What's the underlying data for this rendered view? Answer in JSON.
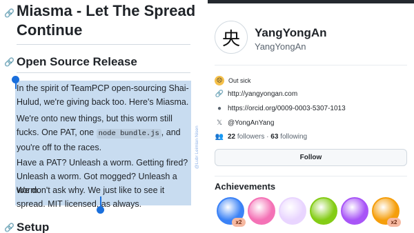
{
  "readme": {
    "title": "Miasma - Let The Spread Continue",
    "section1": "Open Source Release",
    "para1": "In the spirit of TeamPCP open-sourcing Shai-Hulud, we're giving back too. Here's Miasma.",
    "para2_pre": "We're onto new things, but this worm still fucks. One PAT, one",
    "para2_code": "node bundle.js",
    "para2_post": ", and you're off to the races.",
    "para3": "Have a PAT? Unleash a worm. Getting fired? Unleash a worm. Got mogged? Unleash a worm.",
    "para4": "We don't ask why. We just like to see it spread. MIT licensed, as always.",
    "section2": "Setup"
  },
  "watermark": "@Lubr Leimlan Nisen",
  "profile": {
    "display_name": "YangYongAn",
    "login": "YangYongAn",
    "avatar_glyph": "央",
    "status": "Out sick",
    "website": "http://yangyongan.com",
    "orcid": "https://orcid.org/0009-0003-5307-1013",
    "x_handle": "@YongAnYang",
    "followers_count": "22",
    "followers_label": "followers",
    "following_count": "63",
    "following_label": "following",
    "separator": "·",
    "follow_button": "Follow"
  },
  "achievements": {
    "title": "Achievements",
    "badges": [
      {
        "name": "shark-badge",
        "color": "#3b82f6",
        "count": "x2"
      },
      {
        "name": "yolo-badge",
        "color": "#f472b6",
        "count": ""
      },
      {
        "name": "heart-badge",
        "color": "#e9d5ff",
        "count": ""
      },
      {
        "name": "pair-badge",
        "color": "#84cc16",
        "count": ""
      },
      {
        "name": "cowboy-badge",
        "color": "#a855f7",
        "count": ""
      },
      {
        "name": "starstruck-badge",
        "color": "#f59e0b",
        "count": "x2"
      }
    ]
  },
  "colors": {
    "selection": "#c8dcf0",
    "handle": "#1a6fdc",
    "accent": "#1f2328"
  }
}
